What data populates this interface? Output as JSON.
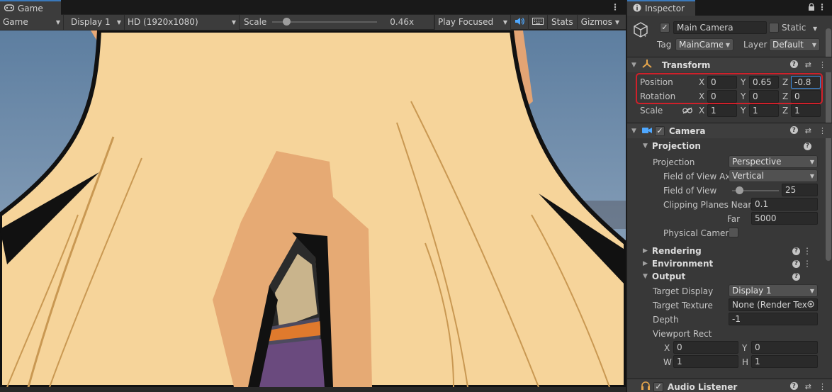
{
  "game": {
    "tab_label": "Game",
    "mode": "Game",
    "display": "Display 1",
    "resolution": "HD (1920x1080)",
    "scale_label": "Scale",
    "scale_value": "0.46x",
    "scale_fraction": 0.1,
    "play_mode": "Play Focused",
    "stats": "Stats",
    "gizmos": "Gizmos"
  },
  "inspector": {
    "tab_label": "Inspector",
    "object_name": "Main Camera",
    "static_label": "Static",
    "tag_label": "Tag",
    "tag_value": "MainCamera",
    "layer_label": "Layer",
    "layer_value": "Default",
    "transform": {
      "title": "Transform",
      "position_label": "Position",
      "rotation_label": "Rotation",
      "scale_label": "Scale",
      "position": {
        "x": "0",
        "y": "0.65",
        "z": "-0.8"
      },
      "rotation": {
        "x": "0",
        "y": "0",
        "z": "0"
      },
      "scale": {
        "x": "1",
        "y": "1",
        "z": "1"
      },
      "highlight_color": "#d0202a"
    },
    "camera": {
      "title": "Camera",
      "projection_section": "Projection",
      "projection_label": "Projection",
      "projection_value": "Perspective",
      "fov_axis_label": "Field of View Ax",
      "fov_axis_value": "Vertical",
      "fov_label": "Field of View",
      "fov_value": "25",
      "fov_fraction": 0.15,
      "clip_near_label": "Clipping Planes Near",
      "clip_near_value": "0.1",
      "clip_far_label": "Far",
      "clip_far_value": "5000",
      "physical_label": "Physical Camer",
      "rendering_section": "Rendering",
      "environment_section": "Environment",
      "output_section": "Output",
      "target_display_label": "Target Display",
      "target_display_value": "Display 1",
      "target_texture_label": "Target Texture",
      "target_texture_value": "None (Render Text",
      "depth_label": "Depth",
      "depth_value": "-1",
      "viewport_rect_label": "Viewport Rect",
      "vr_x": "0",
      "vr_y": "0",
      "vr_w": "1",
      "vr_h": "1"
    },
    "audio_listener": {
      "title": "Audio Listener"
    }
  },
  "axis_labels": {
    "x": "X",
    "y": "Y",
    "z": "Z",
    "w": "W",
    "h": "H"
  },
  "colors": {
    "accent": "#3a79bb",
    "focus": "#3d8ce0"
  }
}
